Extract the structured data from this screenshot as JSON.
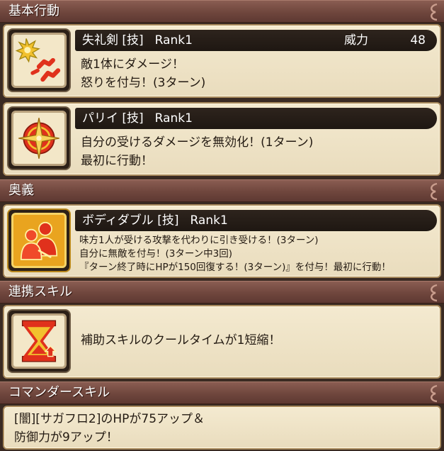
{
  "sections": {
    "basic": "基本行動",
    "ougi": "奥義",
    "renkei": "連携スキル",
    "commander": "コマンダースキル"
  },
  "skills": {
    "shitsurei": {
      "name": "失礼剣 [技]",
      "rank": "Rank1",
      "power_label": "威力",
      "power_value": "48",
      "lines": [
        "敵1体にダメージ！",
        "怒りを付与！(3ターン)"
      ]
    },
    "parry": {
      "name": "パリイ [技]",
      "rank": "Rank1",
      "lines": [
        "自分の受けるダメージを無効化！(1ターン)",
        "最初に行動！"
      ]
    },
    "bodydouble": {
      "name": "ボディダブル [技]",
      "rank": "Rank1",
      "lines": [
        "味方1人が受ける攻撃を代わりに引き受ける！(3ターン)",
        "自分に無敵を付与！(3ターン中3回)",
        "『ターン終了時にHPが150回復する！(3ターン)』を付与！最初に行動！"
      ]
    }
  },
  "renkei_skill": {
    "text": "補助スキルのクールタイムが1短縮！"
  },
  "commander_skill": {
    "lines": [
      "[闇][サガフロ2]のHPが75アップ＆",
      "防御力が9アップ！"
    ]
  },
  "colors": {
    "header": "#6f463d",
    "card": "#efe3c6",
    "title_bar": "#241c16",
    "icon_red": "#e0311c",
    "icon_yellow": "#f2c12e"
  },
  "icons": {
    "shitsurei": "anger-burst-icon",
    "parry": "parry-shield-icon",
    "bodydouble": "body-double-icon",
    "renkei": "hourglass-icon"
  }
}
